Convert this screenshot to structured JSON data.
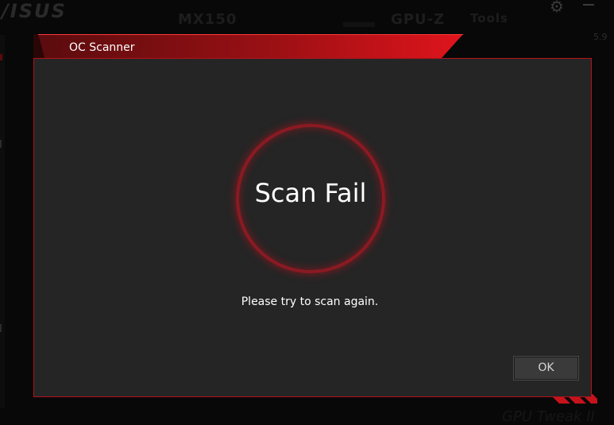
{
  "background_app": {
    "logo": "/ISUS",
    "nav": {
      "gpu_name": "MX150",
      "gpuz": "GPU-Z",
      "tools": "Tools"
    },
    "right_number": "5.9",
    "corner_text": "GPU Tweak II"
  },
  "dialog": {
    "title": "OC Scanner",
    "result": "Scan Fail",
    "message": "Please try to scan again.",
    "ok_label": "OK"
  },
  "colors": {
    "accent_red": "#d1141e",
    "panel_bg": "#252525",
    "ring_red": "#8a1a22"
  }
}
